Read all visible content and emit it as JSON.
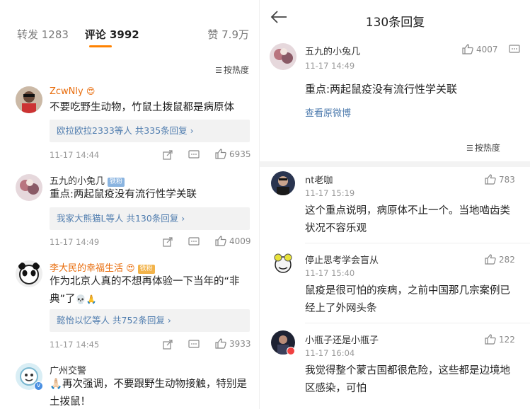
{
  "left": {
    "tabs": {
      "repost": "转发 1283",
      "comments": "评论 3992",
      "likes": "赞 7.9万"
    },
    "sort_label": "按热度",
    "comments": [
      {
        "user": "ZcwNly",
        "text": "不要吃野生动物，竹鼠土拨鼠都是病原体",
        "reply_users": "欧拉欧拉2333等人",
        "reply_count": "共335条回复",
        "time": "11-17 14:44",
        "likes": "6935"
      },
      {
        "user": "五九的小兔几",
        "badge": "铁粉",
        "text": "重点:两起鼠疫没有流行性学关联",
        "reply_users": "我家大熊猫L等人",
        "reply_count": "共130条回复",
        "time": "11-17 14:49",
        "likes": "4009"
      },
      {
        "user": "李大民的幸福生活",
        "badge": "铁粉",
        "text_line1": "作为北京人真的不想再体验一下当年的“非",
        "text_line2": "典”了",
        "reply_users": "懿怡以忆等人",
        "reply_count": "共752条回复",
        "time": "11-17 14:45",
        "likes": "3933"
      },
      {
        "user": "广州交警",
        "text_line1": "🙏🏻再次强调，不要跟野生动物接触，特别是",
        "text_line2": "土拨鼠！"
      }
    ]
  },
  "right": {
    "title": "130条回复",
    "root": {
      "user": "五九的小兔几",
      "time": "11-17 14:49",
      "likes": "4007",
      "text": "重点:两起鼠疫没有流行性学关联",
      "view_original": "查看原微博"
    },
    "sort_label": "按热度",
    "replies": [
      {
        "user": "nt老咖",
        "time": "11-17 15:19",
        "likes": "783",
        "text_line1": "这个重点说明，病原体不止一个。当地啮齿类",
        "text_line2": "状况不容乐观"
      },
      {
        "user": "停止思考学会盲从",
        "time": "11-17 15:40",
        "likes": "282",
        "text_line1": "鼠疫是很可怕的疾病，之前中国那几宗案例已",
        "text_line2": "经上了外网头条"
      },
      {
        "user": "小瓶子还是小瓶子",
        "time": "11-17 16:04",
        "likes": "122",
        "text_line1": "我觉得整个蒙古国都很危险，这些都是边境地",
        "text_line2": "区感染，可怕"
      }
    ]
  },
  "colors": {
    "accent_orange": "#ff8200",
    "link_blue": "#507daf",
    "username_orange": "#e86b0a",
    "username_blue": "#333333"
  }
}
